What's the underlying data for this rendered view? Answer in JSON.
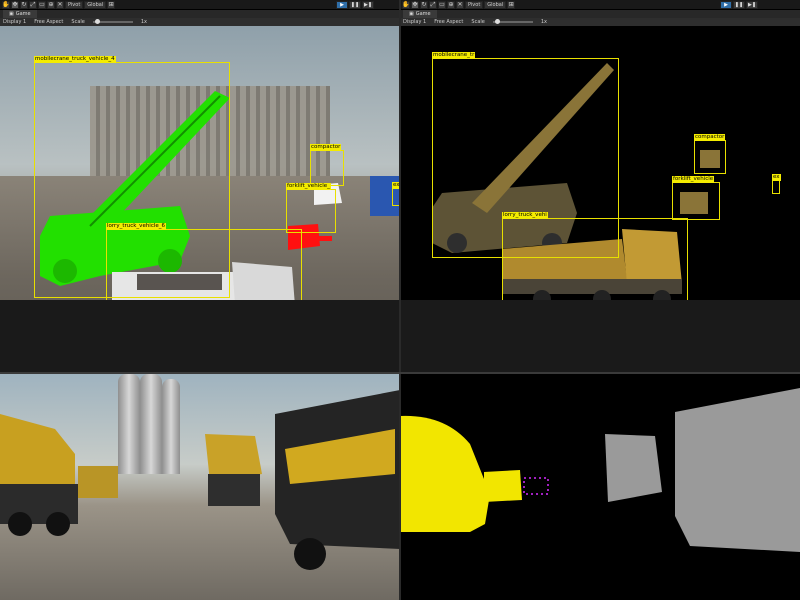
{
  "editor": {
    "toolbar": {
      "pivot_label": "Pivot",
      "global_label": "Global",
      "play_icon": "play-icon",
      "pause_icon": "pause-icon",
      "step_icon": "step-icon"
    },
    "tab": {
      "label": "Game"
    },
    "gamebar": {
      "display": "Display 1",
      "aspect": "Free Aspect",
      "scale_label": "Scale",
      "scale_value": "1x"
    }
  },
  "views": {
    "top_left": {
      "boxes": [
        {
          "label": "mobilecrane_truck_vehicle_4"
        },
        {
          "label": "compactor"
        },
        {
          "label": "forklift_vehicle_"
        },
        {
          "label": "lorry_truck_vehicle_6"
        },
        {
          "label": "ex"
        }
      ]
    },
    "top_right": {
      "boxes": [
        {
          "label": "mobilecrane_tr"
        },
        {
          "label": "compactor"
        },
        {
          "label": "forklift_vehicle"
        },
        {
          "label": "lorry_truck_vehi"
        },
        {
          "label": "ex"
        }
      ]
    }
  },
  "colors": {
    "bbox": "#e8e000",
    "crane_mask": "#22e000",
    "truck_mask": "#e6e6e6",
    "forklift_mask": "#ff1010",
    "segment_yellow": "#f2e600",
    "segment_gray": "#9a9a9a"
  }
}
